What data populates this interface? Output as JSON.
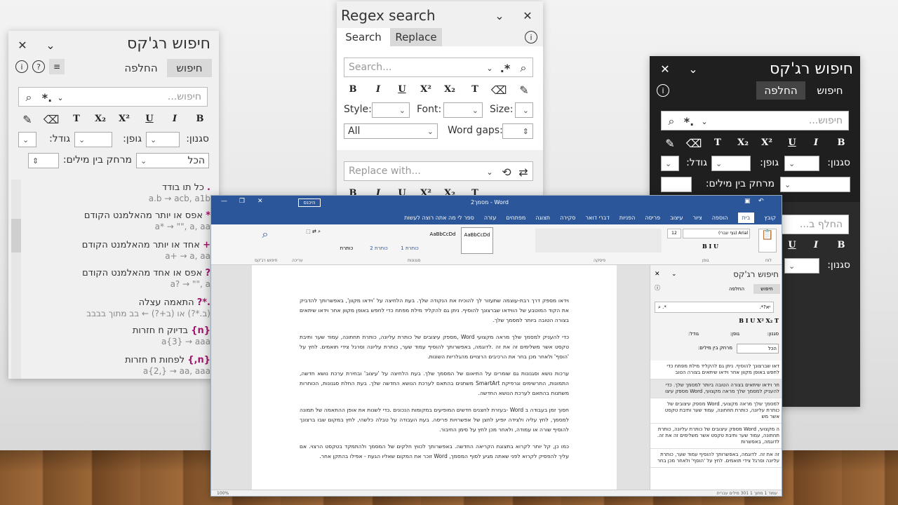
{
  "left_panel": {
    "title": "חיפוש רג'קס",
    "tabs": [
      "חיפוש",
      "החלפה"
    ],
    "search_placeholder": "חיפוש...",
    "style_label": "סגנון:",
    "font_label": "גופן:",
    "size_label": "גודל:",
    "scope_value": "הכל",
    "word_gaps_label": "מרחק בין מילים:",
    "patterns": [
      {
        "token": ".",
        "desc": "כל תו בודד",
        "example": "a.b → acb, a1b"
      },
      {
        "token": "*",
        "desc": "אפס או יותר מהאלמנט הקודם",
        "example": "a* → \"\", a, aa"
      },
      {
        "token": "+",
        "desc": "אחד או יותר מהאלמנט הקודם",
        "example": "a+ → a, aa"
      },
      {
        "token": "?",
        "desc": "אפס או אחד מהאלמנט הקודם",
        "example": "a? → \"\", a"
      },
      {
        "token": ".*?",
        "desc": "התאמה עצלה",
        "example": "(ב.*?) או (ב+?) ← בב מתוך בבבב"
      },
      {
        "token": "{n}",
        "desc": "בדיוק n חזרות",
        "example": "a{3} → aaa"
      },
      {
        "token": "{n,}",
        "desc": "לפחות n חזרות",
        "example": "a{2,} → aa, aaa"
      }
    ]
  },
  "center_panel": {
    "title": "Regex search",
    "tabs": [
      "Search",
      "Replace"
    ],
    "search_placeholder": "Search...",
    "replace_placeholder": "Replace with...",
    "style_label": "Style:",
    "font_label": "Font:",
    "size_label": "Size:",
    "scope_value": "All",
    "word_gaps_label": "Word gaps:"
  },
  "dark_panel": {
    "title": "חיפוש רג'קס",
    "tabs": [
      "חיפוש",
      "החלפה"
    ],
    "search_placeholder": "חיפוש...",
    "replace_placeholder": "החלף ב...",
    "style_label": "סגנון:",
    "font_label": "גופן:",
    "size_label": "גודל:",
    "word_gaps_label": "מרחק בין מילים:"
  },
  "format_buttons": [
    "B",
    "I",
    "U",
    "X²",
    "X₂",
    "T"
  ],
  "word": {
    "title": "מסמך2 - Word",
    "signin": "היכנס",
    "menu": [
      "קובץ",
      "בית",
      "הוספה",
      "ציור",
      "עיצוב",
      "פריסה",
      "הפניות",
      "דברי דואר",
      "סקירה",
      "תצוגה",
      "מפתחים",
      "עזרה",
      "ספר לי מה אתה רוצה לעשות"
    ],
    "styles": [
      "AaBbCcDd",
      "AaBbCcDd",
      "כותרת 1",
      "כותרת 2",
      "כותרת"
    ],
    "groups": [
      "לוח",
      "גופן",
      "פיסקה",
      "סגנונות",
      "עריכה",
      "חיפוש רג'קס"
    ],
    "font_name": "Arial (גוף עברי)",
    "font_size": "12",
    "pane_search": ".*?יא",
    "paragraphs": [
      "וידאו מספק דרך רבת-עוצמה שתעזור לך להוכיח את הנקודה שלך. בעת הלחיצה על 'וידאו מקוון', באפשרותך להדביק את הקוד המוטבע של הווידאו שברצונך להוסיף. ניתן גם להקליד מילת מפתח כדי לחפש באופן מקוון אחר וידאו שיתאים בצורה הטובה ביותר למסמך שלך.",
      "כדי להעניק למסמך שלך מראה מקצועי Word ,מספק עיצובים של כותרת עליונה, כותרת תחתונה, עמוד שער ותיבת טקסט אשר משלימים זה את זה .לדוגמה, באפשרותך להוסיף עמוד שער, כותרת עליונה וסרגל צידי תואמים. לחץ על 'הוסף' ולאחר מכן בחר את הרכיבים הרצויים מהגלריות השונות.",
      "ערכות נושא וסגנונות גם שומרים על התיאום של המסמך שלך. בעת הלחיצה על 'עיצוב' ובחירת ערכת נושא חדשה, התמונות, התרשימים וגרפיקת SmartArt משתנים בהתאם לערכת הנושא החדשה שלך. בעת החלת סגנונות, הכותרות משתנות בהתאם לערכת הנושא החדשה.",
      "חסוך זמן בעבודה ב Word -בעזרת לחצנים חדשים המופיעים במקומות הנכונים .כדי לשנות את אופן ההתאמה של תמונה למסמך, לחץ עליה ולצידה יופיע לחצן של אפשרויות פריסה. בעת העבודה על טבלה כלשהי, לחץ במקום שבו ברצונך להוסיף שורה או עמודה, ולאחר מכן לחץ על סימן החיבור.",
      "כמו כן, קל יותר לקרוא בתצוגת הקריאה החדשה. באפשרותך לכווץ חלקים של המסמך ולהתמקד בטקסט הרצוי. אם עליך להפסיק לקרוא לפני שאתה מגיע לסוף המסמך, Word זוכר את המקום שאליו הגעת - אפילו בהתקן אחר."
    ],
    "results": [
      "דאו שברצונך להוסיף. ניתן גם להקליד מילת מפתח כדי לחפש באופן מקוון אחר וידאו שיתאים בצורה הטוב",
      "חר וידאו שיתאים בצורה הטובה ביותר למסמך שלך. כדי להעניק למסמך שלך מראה מקצועי, Word מספק עיצו",
      "למסמך שלך מראה מקצועי, Word מספק עיצובים של כותרת עליונה, כותרת תחתונה, עמוד שער ותיבת טקסט אשר מש",
      "ה מקצועי, Word מספק עיצובים של כותרת עליונה, כותרת תחתונה, עמוד שער ותיבת טקסט אשר משלימים זה את זה. לדוגמה, באפשרות",
      "זה את זה. לדוגמה, באפשרותך להוסיף עמוד שער, כותרת עליונה וסרגל צידי תואמים. לחץ על 'הוסף' ולאחר מכן בחר"
    ],
    "status": "עמוד 1 מתוך 1   301 מילים   עברית",
    "zoom": "100%"
  }
}
